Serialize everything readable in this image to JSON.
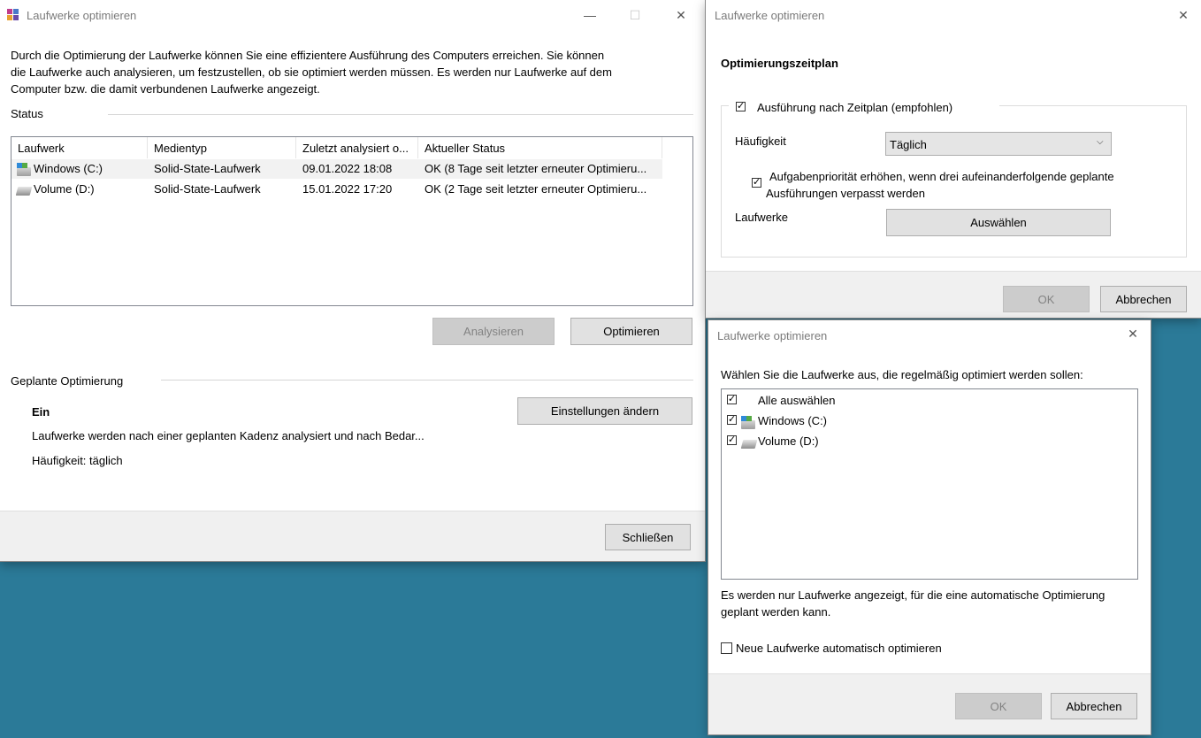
{
  "main": {
    "title": "Laufwerke optimieren",
    "description_lines": [
      "Durch die Optimierung der Laufwerke können Sie eine effizientere Ausführung des Computers erreichen. Sie können",
      "die Laufwerke auch analysieren, um festzustellen, ob sie optimiert werden müssen. Es werden nur Laufwerke auf dem",
      "Computer bzw. die damit verbundenen Laufwerke angezeigt."
    ],
    "status_label": "Status",
    "columns": [
      "Laufwerk",
      "Medientyp",
      "Zuletzt analysiert o...",
      "Aktueller Status"
    ],
    "rows": [
      {
        "drive": "Windows (C:)",
        "media": "Solid-State-Laufwerk",
        "last": "09.01.2022 18:08",
        "status": "OK (8 Tage seit letzter erneuter Optimieru...",
        "icon": "system-drive-icon"
      },
      {
        "drive": "Volume (D:)",
        "media": "Solid-State-Laufwerk",
        "last": "15.01.2022 17:20",
        "status": "OK (2 Tage seit letzter erneuter Optimieru...",
        "icon": "drive-icon"
      }
    ],
    "analyze_label": "Analysieren",
    "optimize_label": "Optimieren",
    "scheduled_label": "Geplante Optimierung",
    "scheduled_state": "Ein",
    "scheduled_desc": "Laufwerke werden nach einer geplanten Kadenz analysiert und nach Bedar...",
    "frequency_text": "Häufigkeit: täglich",
    "change_settings_label": "Einstellungen ändern",
    "close_label": "Schließen"
  },
  "schedule": {
    "title": "Laufwerke optimieren",
    "heading": "Optimierungszeitplan",
    "run_on_schedule_label": "Ausführung nach Zeitplan (empfohlen)",
    "run_on_schedule_checked": true,
    "frequency_label": "Häufigkeit",
    "frequency_value": "Täglich",
    "priority_label_lines": [
      "Aufgabenpriorität erhöhen, wenn drei aufeinanderfolgende geplante",
      "Ausführungen verpasst werden"
    ],
    "priority_checked": true,
    "drives_label": "Laufwerke",
    "select_label": "Auswählen",
    "ok_label": "OK",
    "cancel_label": "Abbrechen"
  },
  "drives_dialog": {
    "title": "Laufwerke optimieren",
    "instruction": "Wählen Sie die Laufwerke aus, die regelmäßig optimiert werden sollen:",
    "items": [
      {
        "label": "Alle auswählen",
        "checked": true,
        "icon": ""
      },
      {
        "label": "Windows (C:)",
        "checked": true,
        "icon": "system-drive-icon"
      },
      {
        "label": "Volume (D:)",
        "checked": true,
        "icon": "drive-icon"
      }
    ],
    "note_lines": [
      "Es werden nur Laufwerke angezeigt, für die eine automatische Optimierung",
      "geplant werden kann."
    ],
    "auto_new_label": "Neue Laufwerke automatisch optimieren",
    "auto_new_checked": false,
    "ok_label": "OK",
    "cancel_label": "Abbrechen"
  },
  "check_glyph": "✓",
  "colors": {
    "desktop": "#2b7a98",
    "footer": "#f0f0f0",
    "button": "#e1e1e1",
    "disabled_button": "#cccccc",
    "selected_row": "#f2f2f2"
  }
}
